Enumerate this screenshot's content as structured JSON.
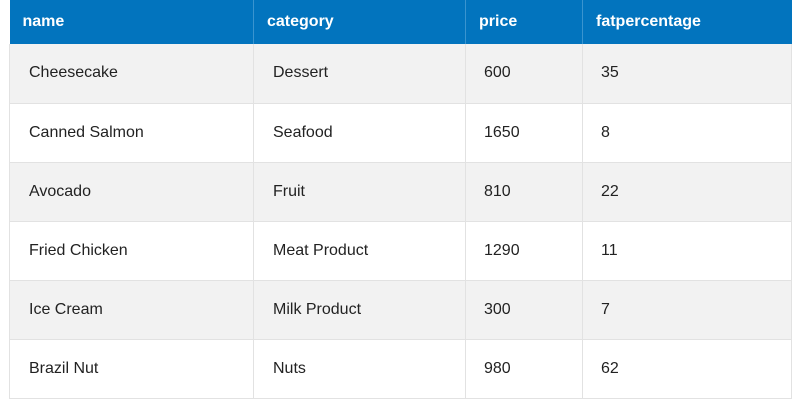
{
  "table": {
    "headers": [
      "name",
      "category",
      "price",
      "fatpercentage"
    ],
    "rows": [
      [
        "Cheesecake",
        "Dessert",
        "600",
        "35"
      ],
      [
        "Canned Salmon",
        "Seafood",
        "1650",
        "8"
      ],
      [
        "Avocado",
        "Fruit",
        "810",
        "22"
      ],
      [
        "Fried Chicken",
        "Meat Product",
        "1290",
        "11"
      ],
      [
        "Ice Cream",
        "Milk Product",
        "300",
        "7"
      ],
      [
        "Brazil Nut",
        "Nuts",
        "980",
        "62"
      ]
    ]
  },
  "colors": {
    "header_bg": "#0274be",
    "header_text": "#ffffff",
    "row_alt_bg": "#f2f2f2",
    "row_bg": "#ffffff",
    "border": "#e2e2e2"
  }
}
